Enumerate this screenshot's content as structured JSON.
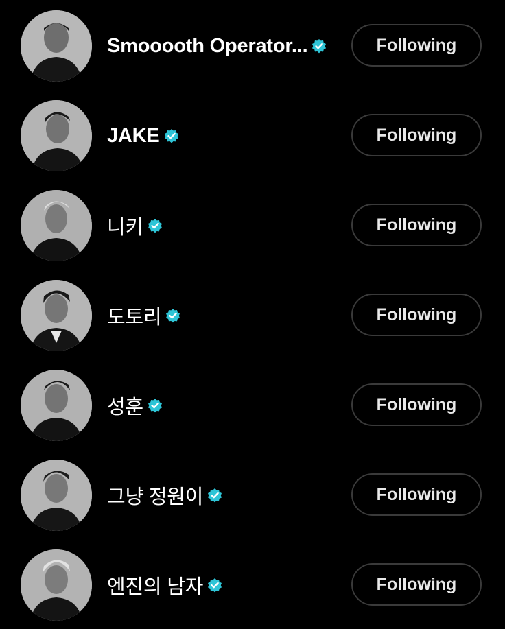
{
  "accent_verified": "#2ec4d6",
  "button_border": "#3a3a3a",
  "accounts": [
    {
      "name": "Smooooth Operator...",
      "verified": true,
      "button_label": "Following",
      "avatar_icon": "profile-photo"
    },
    {
      "name": "JAKE",
      "verified": true,
      "button_label": "Following",
      "avatar_icon": "profile-photo"
    },
    {
      "name": "니키",
      "verified": true,
      "button_label": "Following",
      "avatar_icon": "profile-photo"
    },
    {
      "name": "도토리",
      "verified": true,
      "button_label": "Following",
      "avatar_icon": "profile-photo"
    },
    {
      "name": "성훈",
      "verified": true,
      "button_label": "Following",
      "avatar_icon": "profile-photo"
    },
    {
      "name": "그냥 정원이",
      "verified": true,
      "button_label": "Following",
      "avatar_icon": "profile-photo"
    },
    {
      "name": "엔진의 남자",
      "verified": true,
      "button_label": "Following",
      "avatar_icon": "profile-photo"
    }
  ]
}
